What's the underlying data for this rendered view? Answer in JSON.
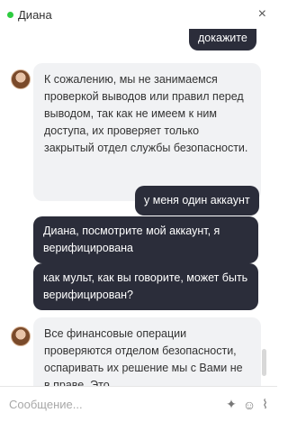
{
  "header": {
    "agent_name": "Диана",
    "status": "online",
    "close_label": "×"
  },
  "messages": [
    {
      "from": "user",
      "text": "докажите"
    },
    {
      "from": "agent",
      "text": "К сожалению, мы не занимаемся проверкой выводов или правил перед выводом, так как не имеем к ним доступа, их проверяет только закрытый отдел службы безопасности."
    },
    {
      "from": "user",
      "text": "у меня один аккаунт"
    },
    {
      "from": "user",
      "text": "Диана, посмотрите мой аккаунт, я верифицирована"
    },
    {
      "from": "user",
      "text": "как мульт, как вы говорите, может быть верифицирован?"
    },
    {
      "from": "agent",
      "text": "Все финансовые операции проверяются отделом безопасности, оспаривать их решение мы с Вами не в праве. Это"
    }
  ],
  "composer": {
    "placeholder": "Сообщение...",
    "icons": [
      "magic-wand-icon",
      "emoji-icon",
      "paperclip-icon"
    ]
  },
  "colors": {
    "outgoing_bubble": "#2b2d3a",
    "incoming_bubble": "#f1f2f4",
    "status_online": "#2ecc40"
  }
}
